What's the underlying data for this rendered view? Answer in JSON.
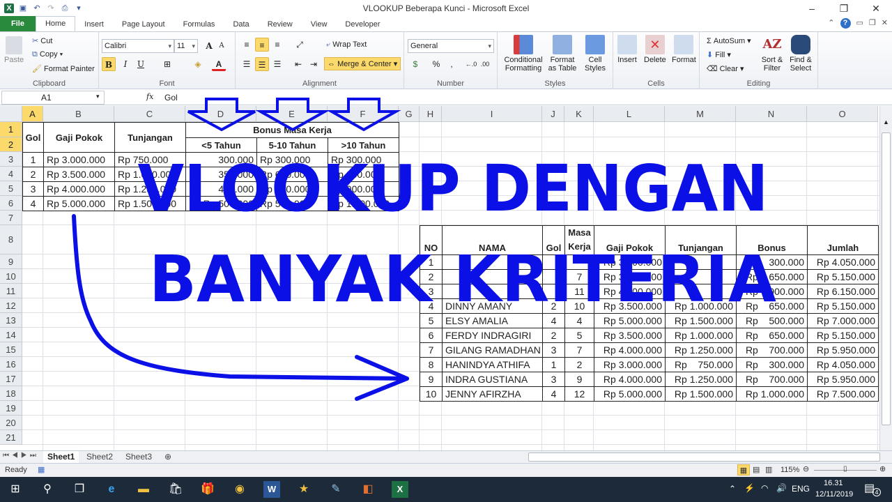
{
  "window": {
    "title": "VLOOKUP Beberapa Kunci  -  Microsoft Excel",
    "controls": {
      "minimize": "–",
      "restore": "❐",
      "close": "✕"
    }
  },
  "ribbon_tabs": [
    "File",
    "Home",
    "Insert",
    "Page Layout",
    "Formulas",
    "Data",
    "Review",
    "View",
    "Developer"
  ],
  "active_tab": "Home",
  "ribbon": {
    "clipboard": {
      "label": "Clipboard",
      "paste": "Paste",
      "cut": "Cut",
      "copy": "Copy",
      "format_painter": "Format Painter"
    },
    "font": {
      "label": "Font",
      "font_name": "Calibri",
      "font_size": "11",
      "bold": "B",
      "italic": "I",
      "underline": "U"
    },
    "alignment": {
      "label": "Alignment",
      "wrap_text": "Wrap Text",
      "merge_center": "Merge & Center"
    },
    "number": {
      "label": "Number",
      "format": "General",
      "percent": "%",
      "comma": ","
    },
    "styles": {
      "label": "Styles",
      "conditional_formatting": "Conditional Formatting",
      "format_as_table": "Format as Table",
      "cell_styles": "Cell Styles"
    },
    "cells": {
      "label": "Cells",
      "insert": "Insert",
      "delete": "Delete",
      "format": "Format"
    },
    "editing": {
      "label": "Editing",
      "autosum": "AutoSum",
      "fill": "Fill",
      "clear": "Clear",
      "sort_filter": "Sort & Filter",
      "find_select": "Find & Select"
    }
  },
  "formula_bar": {
    "name_box": "A1",
    "fx": "fx",
    "value": "Gol"
  },
  "columns": [
    "A",
    "B",
    "C",
    "D",
    "E",
    "F",
    "G",
    "H",
    "I",
    "J",
    "K",
    "L",
    "M",
    "N",
    "O"
  ],
  "selected_column": "A",
  "rows": [
    "1",
    "2",
    "3",
    "4",
    "5",
    "6",
    "7",
    "8",
    "9",
    "10",
    "11",
    "12",
    "13",
    "14",
    "15",
    "16",
    "17",
    "18",
    "19",
    "20",
    "21"
  ],
  "lookup_table": {
    "headers": {
      "gol": "Gol",
      "gaji_pokok": "Gaji Pokok",
      "tunjangan": "Tunjangan",
      "bonus_group": "Bonus Masa Kerja",
      "lt5": "<5 Tahun",
      "5to10": "5-10 Tahun",
      "gt10": ">10 Tahun"
    },
    "rows": [
      {
        "gol": "1",
        "gaji": "Rp 3.000.000",
        "tunj": "Rp    750.000",
        "b1": "300.000",
        "b2": "Rp    300.000",
        "b3": "Rp    300.000"
      },
      {
        "gol": "2",
        "gaji": "Rp 3.500.000",
        "tunj": "Rp 1.000.000",
        "b1": "350.000",
        "b2": "Rp    650.000",
        "b3": "Rp    650.000"
      },
      {
        "gol": "3",
        "gaji": "Rp 4.000.000",
        "tunj": "Rp 1.250.000",
        "b1": "400.000",
        "b2": "Rp    700.000",
        "b3": "Rp    900.000"
      },
      {
        "gol": "4",
        "gaji": "Rp 5.000.000",
        "tunj": "Rp 1.500.000",
        "b1": "Rp    500.000",
        "b2": "Rp    500.000",
        "b3": "Rp 1.000.000"
      }
    ]
  },
  "main_table": {
    "headers": [
      "NO",
      "NAMA",
      "Gol",
      "Masa Kerja",
      "Gaji Pokok",
      "Tunjangan",
      "Bonus",
      "Jumlah"
    ],
    "rows": [
      [
        "1",
        "",
        "",
        "",
        "Rp 3.000.000",
        "",
        "Rp    300.000",
        "Rp 4.050.000"
      ],
      [
        "2",
        "",
        "",
        "7",
        "Rp 3.500.000",
        "",
        "Rp    650.000",
        "Rp 5.150.000"
      ],
      [
        "3",
        "",
        "",
        "11",
        "Rp 4.000.000",
        "",
        "Rp    900.000",
        "Rp 6.150.000"
      ],
      [
        "4",
        "DINNY AMANY",
        "2",
        "10",
        "Rp 3.500.000",
        "Rp 1.000.000",
        "Rp    650.000",
        "Rp 5.150.000"
      ],
      [
        "5",
        "ELSY AMALIA",
        "4",
        "4",
        "Rp 5.000.000",
        "Rp 1.500.000",
        "Rp    500.000",
        "Rp 7.000.000"
      ],
      [
        "6",
        "FERDY INDRAGIRI",
        "2",
        "5",
        "Rp 3.500.000",
        "Rp 1.000.000",
        "Rp    650.000",
        "Rp 5.150.000"
      ],
      [
        "7",
        "GILANG RAMADHAN",
        "3",
        "7",
        "Rp 4.000.000",
        "Rp 1.250.000",
        "Rp    700.000",
        "Rp 5.950.000"
      ],
      [
        "8",
        "HANINDYA ATHIFA",
        "1",
        "2",
        "Rp 3.000.000",
        "Rp    750.000",
        "Rp    300.000",
        "Rp 4.050.000"
      ],
      [
        "9",
        "INDRA GUSTIANA",
        "3",
        "9",
        "Rp 4.000.000",
        "Rp 1.250.000",
        "Rp    700.000",
        "Rp 5.950.000"
      ],
      [
        "10",
        "JENNY AFIRZHA",
        "4",
        "12",
        "Rp 5.000.000",
        "Rp 1.500.000",
        "Rp 1.000.000",
        "Rp 7.500.000"
      ]
    ]
  },
  "overlay": {
    "line1": "VLOOKUP DENGAN",
    "line2": "BANYAK KRITERIA",
    "color": "#0a10e6"
  },
  "sheet_tabs": [
    "Sheet1",
    "Sheet2",
    "Sheet3"
  ],
  "active_sheet": "Sheet1",
  "status": {
    "ready": "Ready",
    "zoom": "115%"
  },
  "taskbar": {
    "language": "ENG",
    "time": "16.31",
    "date": "12/11/2019",
    "notifications": "4"
  }
}
